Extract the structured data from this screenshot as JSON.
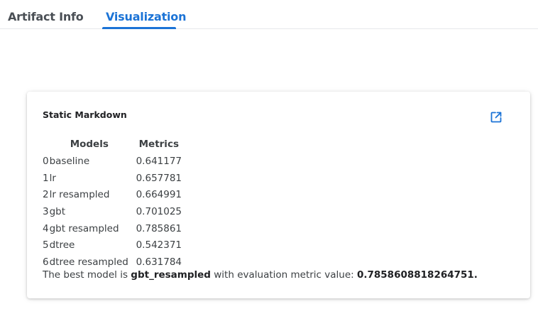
{
  "tabs": [
    {
      "label": "Artifact Info",
      "active": false
    },
    {
      "label": "Visualization",
      "active": true
    }
  ],
  "colors": {
    "accent": "#1b73d6",
    "text": "#3c4043"
  },
  "card": {
    "title": "Static Markdown",
    "open_icon": "open-in-new-icon",
    "table": {
      "headers": [
        "Models",
        "Metrics"
      ],
      "rows": [
        {
          "index": "0",
          "model": "baseline",
          "metric": "0.641177"
        },
        {
          "index": "1",
          "model": "lr",
          "metric": "0.657781"
        },
        {
          "index": "2",
          "model": "lr resampled",
          "metric": "0.664991"
        },
        {
          "index": "3",
          "model": "gbt",
          "metric": "0.701025"
        },
        {
          "index": "4",
          "model": "gbt resampled",
          "metric": "0.785861"
        },
        {
          "index": "5",
          "model": "dtree",
          "metric": "0.542371"
        },
        {
          "index": "6",
          "model": "dtree resampled",
          "metric": "0.631784"
        }
      ]
    },
    "summary": {
      "prefix": "The best model is ",
      "model": "gbt_resampled",
      "middle": " with evaluation metric value: ",
      "value": "0.7858608818264751."
    }
  }
}
